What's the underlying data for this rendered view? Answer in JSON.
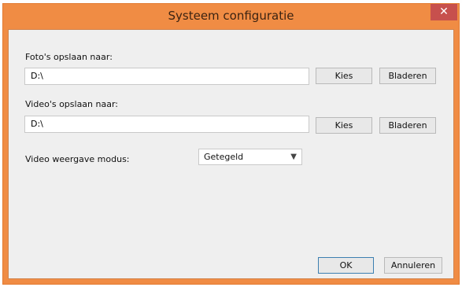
{
  "window": {
    "title": "Systeem configuratie",
    "close_glyph": "✕"
  },
  "photos": {
    "label": "Foto's opslaan naar:",
    "path_value": "D:\\",
    "choose_label": "Kies",
    "browse_label": "Bladeren"
  },
  "videos": {
    "label": "Video's opslaan naar:",
    "path_value": "D:\\",
    "choose_label": "Kies",
    "browse_label": "Bladeren"
  },
  "display_mode": {
    "label": "Video weergave modus:",
    "selected": "Getegeld"
  },
  "footer": {
    "ok_label": "OK",
    "cancel_label": "Annuleren"
  },
  "colors": {
    "titlebar": "#f08c44",
    "client_bg": "#efefef",
    "close_bg": "#c7504d"
  },
  "icons": {
    "dropdown": "chevron-down-icon",
    "close": "close-icon"
  }
}
